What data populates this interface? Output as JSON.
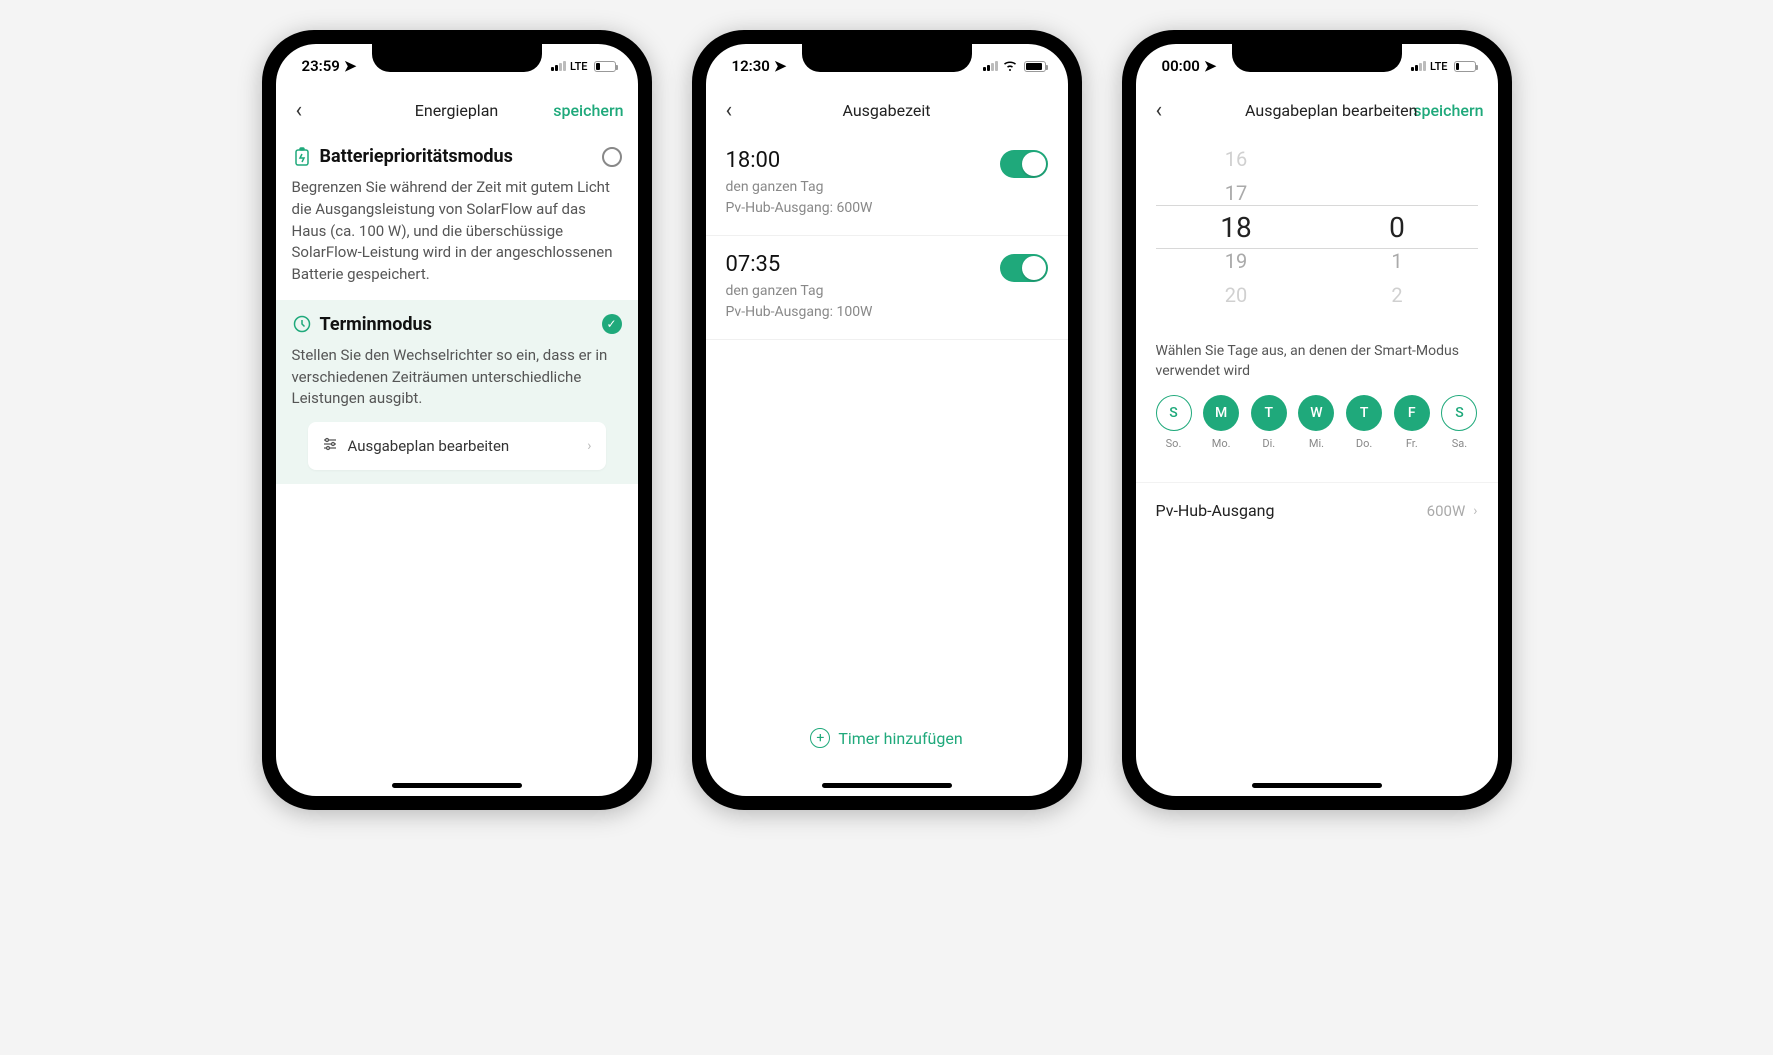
{
  "colors": {
    "accent": "#1fa97b"
  },
  "screen1": {
    "status": {
      "time": "23:59",
      "net": "LTE"
    },
    "nav": {
      "title": "Energieplan",
      "save": "speichern"
    },
    "mode_battery": {
      "title": "Batterieprioritätsmodus",
      "desc": "Begrenzen Sie während der Zeit mit gutem Licht die Ausgangsleistung von SolarFlow auf das Haus (ca. 100 W), und die überschüssige SolarFlow-Leistung wird in der angeschlossenen Batterie gespeichert."
    },
    "mode_schedule": {
      "title": "Terminmodus",
      "desc": "Stellen Sie den Wechselrichter so ein, dass er in verschiedenen Zeiträumen unterschiedliche Leistungen ausgibt.",
      "edit_label": "Ausgabeplan bearbeiten"
    }
  },
  "screen2": {
    "status": {
      "time": "12:30"
    },
    "nav": {
      "title": "Ausgabezeit"
    },
    "timers": [
      {
        "time": "18:00",
        "sub1": "den ganzen Tag",
        "sub2": "Pv-Hub-Ausgang: 600W",
        "on": true
      },
      {
        "time": "07:35",
        "sub1": "den ganzen Tag",
        "sub2": "Pv-Hub-Ausgang: 100W",
        "on": true
      }
    ],
    "add_label": "Timer hinzufügen"
  },
  "screen3": {
    "status": {
      "time": "00:00",
      "net": "LTE"
    },
    "nav": {
      "title": "Ausgabeplan bearbeiten",
      "save": "speichern"
    },
    "picker": {
      "hours": [
        "16",
        "17",
        "18",
        "19",
        "20"
      ],
      "minutes": [
        "",
        "",
        "0",
        "1",
        "2"
      ],
      "selected_hour": "18",
      "selected_minute": "0"
    },
    "days_label": "Wählen Sie Tage aus, an denen der Smart-Modus verwendet wird",
    "days": [
      {
        "letter": "S",
        "sub": "So.",
        "on": false
      },
      {
        "letter": "M",
        "sub": "Mo.",
        "on": true
      },
      {
        "letter": "T",
        "sub": "Di.",
        "on": true
      },
      {
        "letter": "W",
        "sub": "Mi.",
        "on": true
      },
      {
        "letter": "T",
        "sub": "Do.",
        "on": true
      },
      {
        "letter": "F",
        "sub": "Fr.",
        "on": true
      },
      {
        "letter": "S",
        "sub": "Sa.",
        "on": false
      }
    ],
    "hub": {
      "label": "Pv-Hub-Ausgang",
      "value": "600W"
    }
  }
}
